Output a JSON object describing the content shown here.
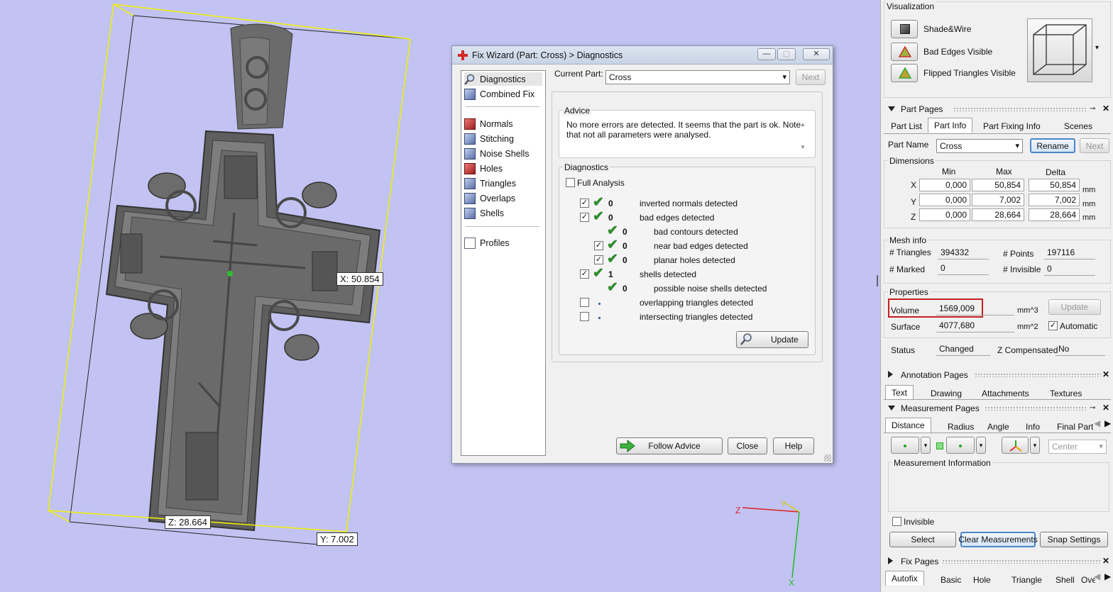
{
  "viewport": {
    "dims": {
      "x": "X: 50.854",
      "y": "Y: 7.002",
      "z": "Z: 28.664"
    },
    "axes": {
      "z": "Z",
      "y": "Y",
      "x": "X"
    },
    "colors": {
      "background": "#c2c3f2",
      "bbox": "#f2f200",
      "model": "#6e6e6e"
    }
  },
  "dialog": {
    "title": "Fix Wizard (Part: Cross) > Diagnostics",
    "window_buttons": {
      "minimize": "—",
      "maximize": "▢",
      "close": "✕"
    },
    "nav": [
      {
        "label": "Diagnostics",
        "icon": "magnifier-icon"
      },
      {
        "label": "Combined Fix",
        "icon": "document-icon"
      },
      {
        "label": "Normals",
        "icon": "cube-icon"
      },
      {
        "label": "Stitching",
        "icon": "cube-icon"
      },
      {
        "label": "Noise Shells",
        "icon": "cube-icon"
      },
      {
        "label": "Holes",
        "icon": "cube-icon"
      },
      {
        "label": "Triangles",
        "icon": "cube-icon"
      },
      {
        "label": "Overlaps",
        "icon": "cube-icon"
      },
      {
        "label": "Shells",
        "icon": "cube-icon"
      },
      {
        "label": "Profiles",
        "icon": "document-icon"
      }
    ],
    "current_part_label": "Current Part:",
    "current_part_value": "Cross",
    "next_label": "Next",
    "advice_title": "Advice",
    "advice_text": "No more errors are detected. It seems that the part is ok. Note that not all parameters were analysed.",
    "diagnostics_title": "Diagnostics",
    "full_analysis": "Full Analysis",
    "rows": [
      {
        "count": "0",
        "text": "inverted normals detected"
      },
      {
        "count": "0",
        "text": "bad edges detected"
      },
      {
        "count": "0",
        "text": "bad contours detected"
      },
      {
        "count": "0",
        "text": "near bad edges detected"
      },
      {
        "count": "0",
        "text": "planar holes detected"
      },
      {
        "count": "1",
        "text": "shells detected"
      },
      {
        "count": "0",
        "text": "possible noise shells detected"
      },
      {
        "count": "",
        "text": "overlapping triangles detected"
      },
      {
        "count": "",
        "text": "intersecting triangles detected"
      }
    ],
    "update_label": "Update",
    "follow_advice": "Follow Advice",
    "close_label": "Close",
    "help_label": "Help"
  },
  "panel": {
    "visualization": {
      "title": "Visualization",
      "items": [
        "Shade&Wire",
        "Bad Edges Visible",
        "Flipped Triangles Visible"
      ]
    },
    "part_pages": {
      "title": "Part Pages",
      "tabs": [
        "Part List",
        "Part Info",
        "Part Fixing Info",
        "Scenes"
      ],
      "part_name_label": "Part Name",
      "part_name_value": "Cross",
      "rename": "Rename",
      "next": "Next",
      "dimensions_title": "Dimensions",
      "cols": [
        "Min",
        "Max",
        "Delta"
      ],
      "rows": [
        {
          "axis": "X",
          "min": "0,000",
          "max": "50,854",
          "delta": "50,854",
          "unit": "mm"
        },
        {
          "axis": "Y",
          "min": "0,000",
          "max": "7,002",
          "delta": "7,002",
          "unit": "mm"
        },
        {
          "axis": "Z",
          "min": "0,000",
          "max": "28,664",
          "delta": "28,664",
          "unit": "mm"
        }
      ],
      "mesh_title": "Mesh info",
      "triangles_label": "# Triangles",
      "triangles_value": "394332",
      "points_label": "# Points",
      "points_value": "197116",
      "marked_label": "# Marked",
      "marked_value": "0",
      "invisible_label": "# Invisible",
      "invisible_value": "0",
      "properties_title": "Properties",
      "volume_label": "Volume",
      "volume_value": "1569,009",
      "volume_unit": "mm^3",
      "update": "Update",
      "surface_label": "Surface",
      "surface_value": "4077,680",
      "surface_unit": "mm^2",
      "automatic": "Automatic",
      "status_label": "Status",
      "status_value": "Changed",
      "zcomp_label": "Z Compensated",
      "zcomp_value": "No"
    },
    "annotation_pages": {
      "title": "Annotation Pages",
      "tabs": [
        "Text",
        "Drawing",
        "Attachments",
        "Textures"
      ]
    },
    "measurement_pages": {
      "title": "Measurement Pages",
      "tabs": [
        "Distance",
        "Radius",
        "Angle",
        "Info",
        "Final Part"
      ],
      "center": "Center",
      "info_title": "Measurement Information",
      "invisible": "Invisible",
      "select": "Select",
      "clear": "Clear Measurements",
      "snap": "Snap Settings"
    },
    "fix_pages": {
      "title": "Fix Pages",
      "tabs": [
        "Autofix",
        "Basic",
        "Hole",
        "Triangle",
        "Shell",
        "Over"
      ]
    },
    "glyphs": {
      "close": "✕",
      "pin": "⊸",
      "arrow_left": "◀",
      "arrow_right": "▶",
      "dropdown": "▾"
    },
    "highlight_color": "#c81e1e"
  }
}
